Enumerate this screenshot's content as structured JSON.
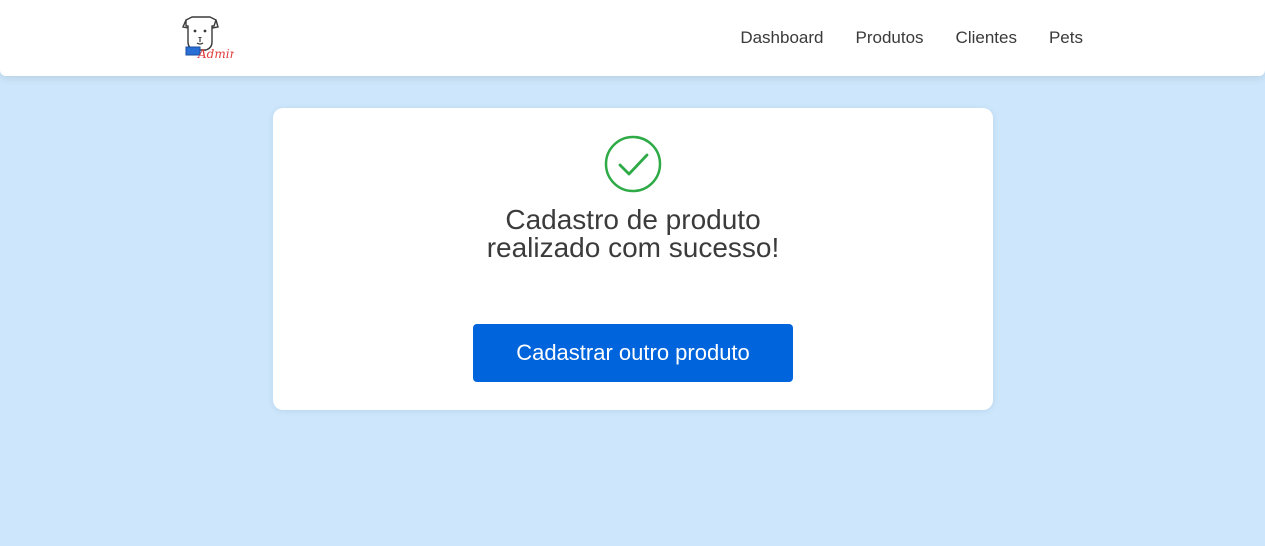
{
  "header": {
    "logo_icon": "petshop-admin-logo-icon",
    "logo_text": "Admin",
    "nav": [
      {
        "label": "Dashboard"
      },
      {
        "label": "Produtos"
      },
      {
        "label": "Clientes"
      },
      {
        "label": "Pets"
      }
    ]
  },
  "card": {
    "icon": "check-circle-icon",
    "message": "Cadastro de produto realizado com sucesso!",
    "button_label": "Cadastrar outro produto"
  },
  "colors": {
    "page_background": "#cde6fb",
    "primary_button": "#0064dc",
    "success_green": "#2eaa46",
    "logo_text_red": "#e23b3b"
  }
}
